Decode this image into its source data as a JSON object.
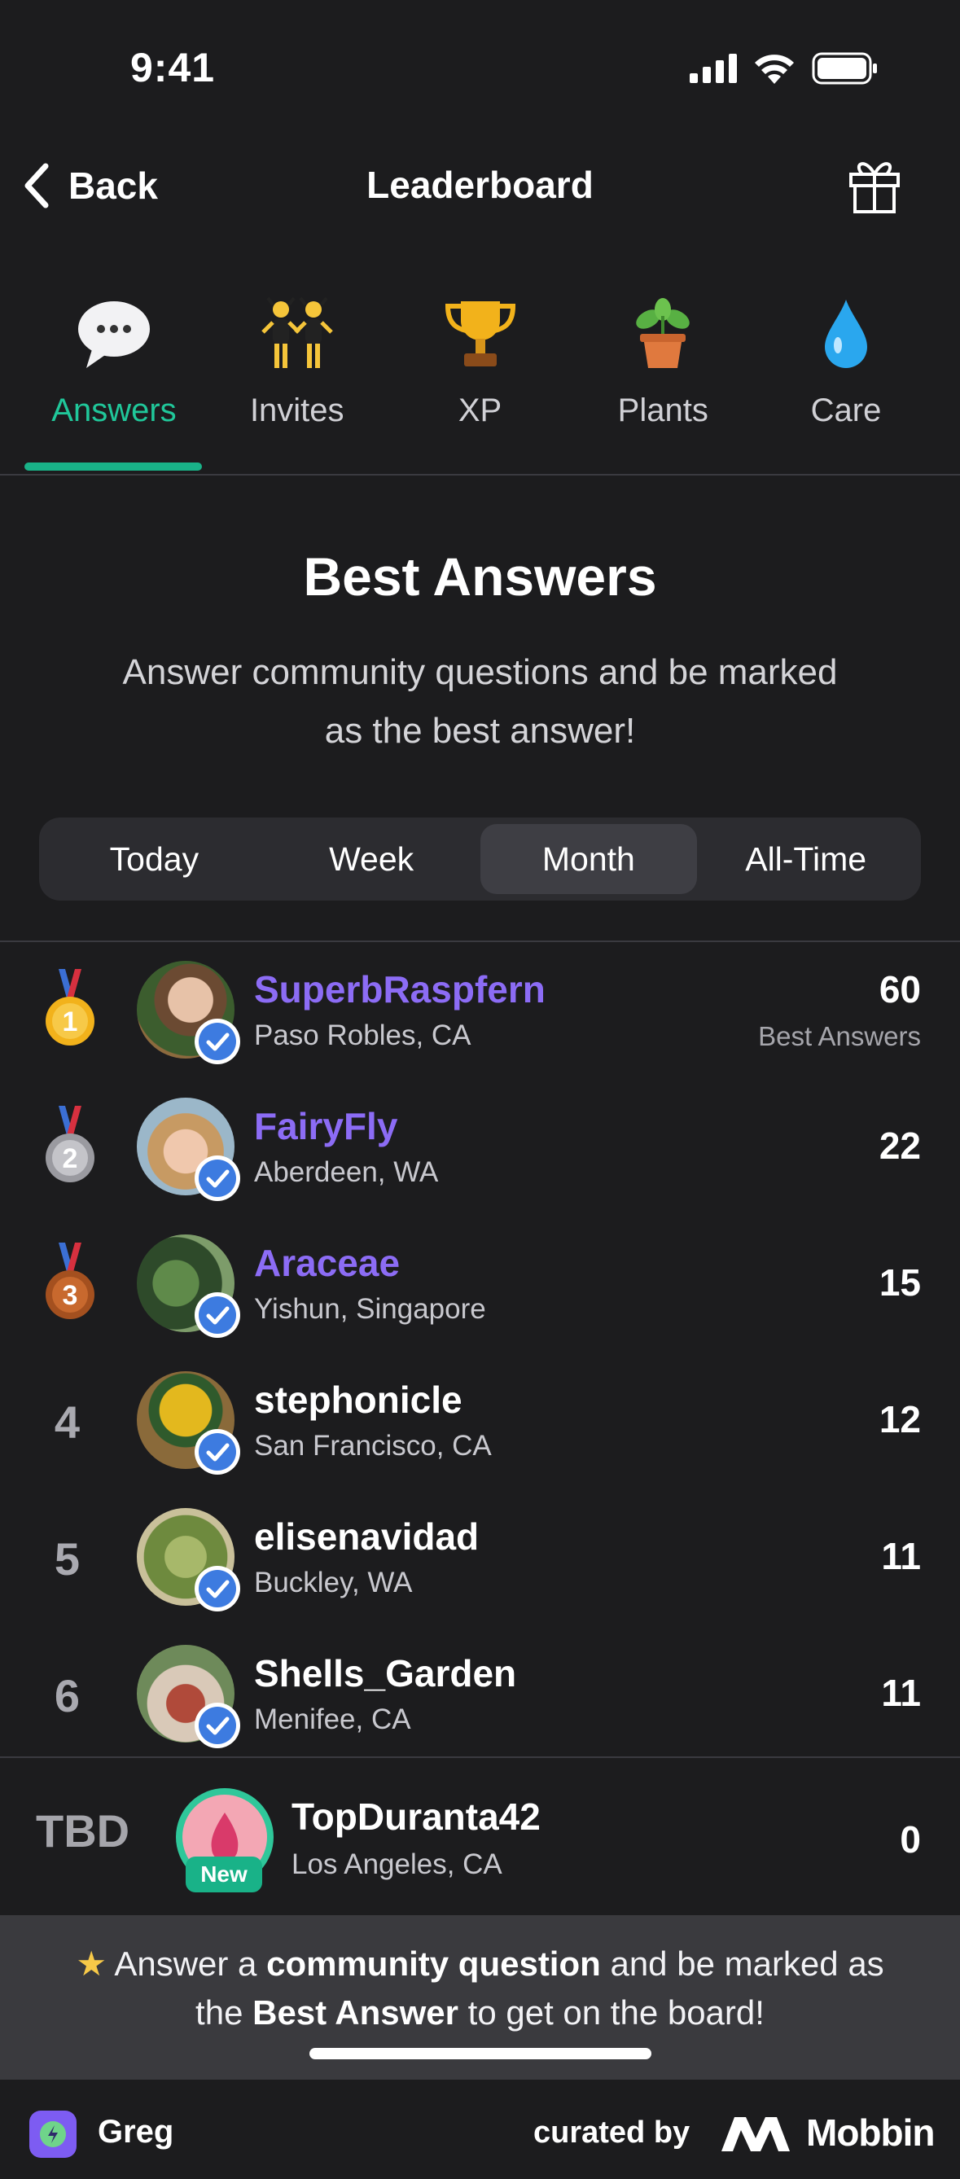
{
  "status_bar": {
    "time": "9:41"
  },
  "nav": {
    "back_label": "Back",
    "title": "Leaderboard"
  },
  "categories": [
    {
      "label": "Answers",
      "icon": "speech-bubble-icon",
      "active": true
    },
    {
      "label": "Invites",
      "icon": "dancers-icon",
      "active": false
    },
    {
      "label": "XP",
      "icon": "trophy-icon",
      "active": false
    },
    {
      "label": "Plants",
      "icon": "potted-plant-icon",
      "active": false
    },
    {
      "label": "Care",
      "icon": "droplet-icon",
      "active": false
    }
  ],
  "header": {
    "title": "Best Answers",
    "subtitle": "Answer community questions and be marked as the best answer!"
  },
  "periods": [
    {
      "label": "Today",
      "active": false
    },
    {
      "label": "Week",
      "active": false
    },
    {
      "label": "Month",
      "active": true
    },
    {
      "label": "All-Time",
      "active": false
    }
  ],
  "leaders": [
    {
      "rank": "1",
      "name": "SuperbRaspfern",
      "location": "Paso Robles, CA",
      "score": "60",
      "caption": "Best Answers"
    },
    {
      "rank": "2",
      "name": "FairyFly",
      "location": "Aberdeen, WA",
      "score": "22"
    },
    {
      "rank": "3",
      "name": "Araceae",
      "location": "Yishun, Singapore",
      "score": "15"
    },
    {
      "rank": "4",
      "name": "stephonicle",
      "location": "San Francisco, CA",
      "score": "12"
    },
    {
      "rank": "5",
      "name": "elisenavidad",
      "location": "Buckley, WA",
      "score": "11"
    },
    {
      "rank": "6",
      "name": "Shells_Garden",
      "location": "Menifee, CA",
      "score": "11"
    }
  ],
  "me": {
    "rank": "TBD",
    "name": "TopDuranta42",
    "location": "Los Angeles, CA",
    "score": "0",
    "badge": "New"
  },
  "cta": {
    "part1": "Answer a ",
    "bold1": "community question",
    "part2": " and be marked as the ",
    "bold2": "Best Answer",
    "part3": " to get on the board!"
  },
  "watermark": {
    "app_name": "Greg",
    "curated_by": "curated by",
    "brand": "Mobbin"
  },
  "colors": {
    "accent_green": "#19b288",
    "top_name_purple": "#8c6cf5",
    "background": "#1c1c1e"
  }
}
